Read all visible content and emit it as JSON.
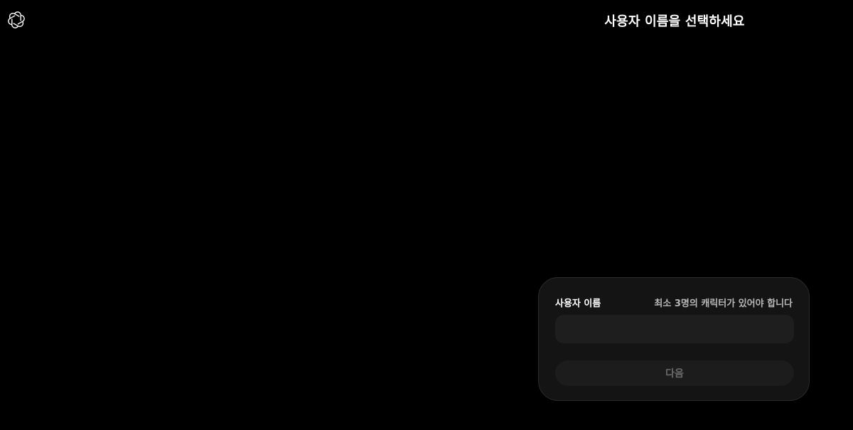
{
  "header": {
    "logo_icon": "openai-logo-icon",
    "title": "사용자 이름을 선택하세요"
  },
  "form": {
    "username_label": "사용자 이름",
    "username_hint": "최소 3명의 캐릭터가 있어야 합니다",
    "username_value": "",
    "username_placeholder": "",
    "next_label": "다음",
    "next_disabled": true
  },
  "colors": {
    "background": "#000000",
    "card_background": "#141414",
    "input_background": "#1e1e1e",
    "button_disabled_text": "#6a6a6a"
  }
}
